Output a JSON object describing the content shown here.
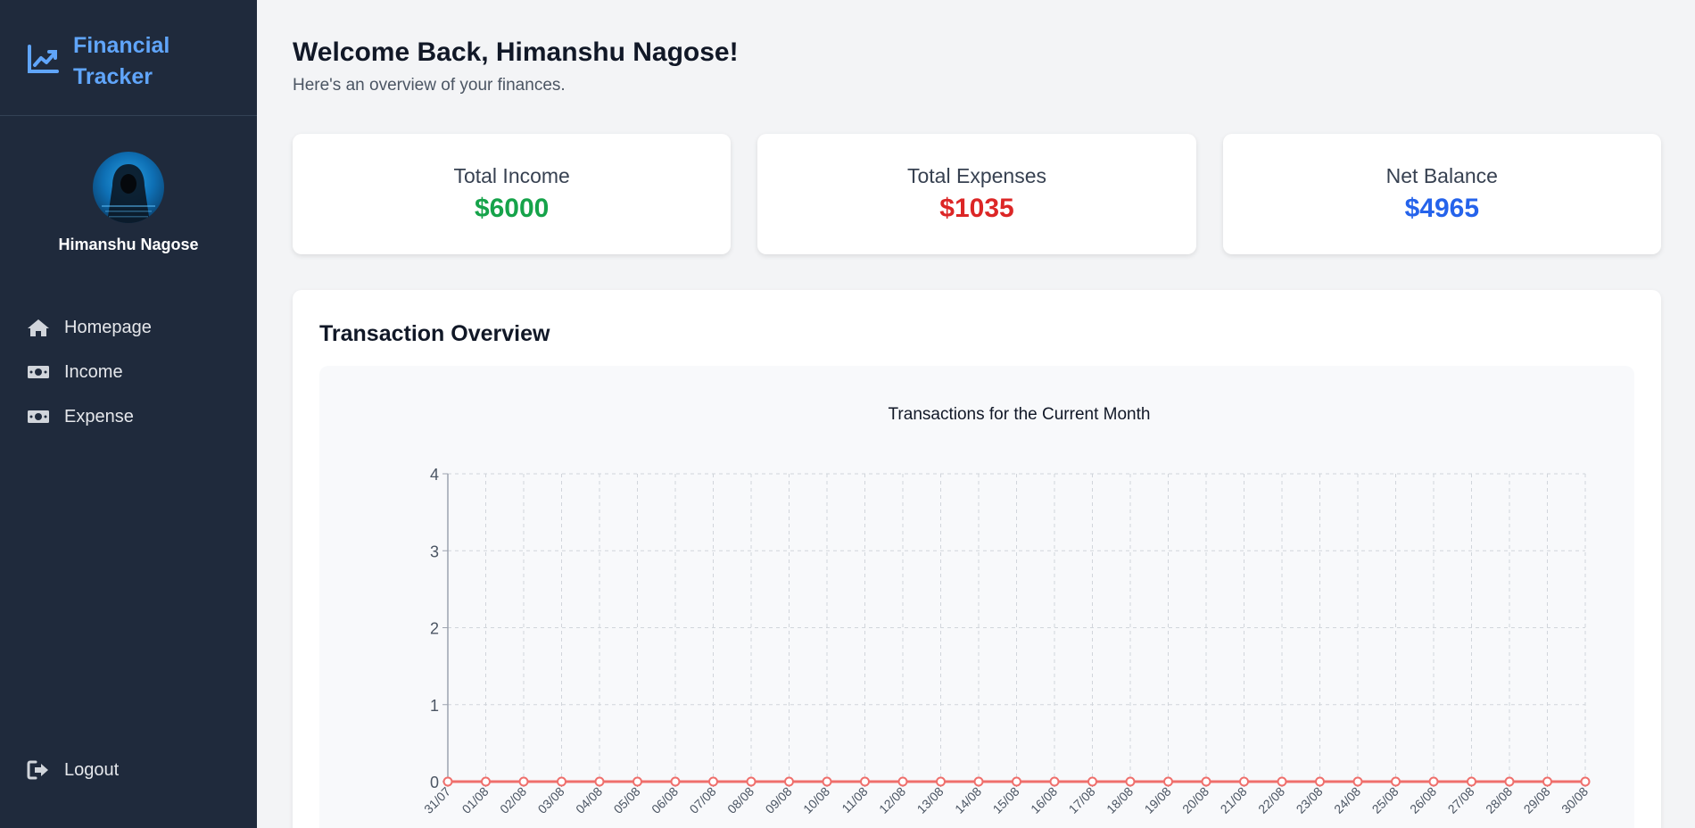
{
  "brand": {
    "title": "Financial Tracker"
  },
  "profile": {
    "name": "Himanshu Nagose"
  },
  "nav": {
    "items": [
      {
        "label": "Homepage",
        "icon": "home-icon"
      },
      {
        "label": "Income",
        "icon": "money-bill-icon"
      },
      {
        "label": "Expense",
        "icon": "money-bill-icon"
      }
    ],
    "logout": {
      "label": "Logout",
      "icon": "sign-out-icon"
    }
  },
  "header": {
    "welcome": "Welcome Back, Himanshu Nagose!",
    "subtitle": "Here's an overview of your finances."
  },
  "summary": {
    "income": {
      "label": "Total Income",
      "value": "$6000",
      "color": "#16a34a"
    },
    "expenses": {
      "label": "Total Expenses",
      "value": "$1035",
      "color": "#dc2626"
    },
    "balance": {
      "label": "Net Balance",
      "value": "$4965",
      "color": "#2563eb"
    }
  },
  "overview": {
    "title": "Transaction Overview"
  },
  "colors": {
    "sidebar": "#1f2a3c",
    "brand": "#60a5fa",
    "line": "#ef6f6c"
  },
  "chart_data": {
    "type": "line",
    "title": "Transactions for the Current Month",
    "xlabel": "",
    "ylabel": "",
    "ylim": [
      0,
      4
    ],
    "yticks": [
      0,
      1,
      2,
      3,
      4
    ],
    "grid": true,
    "categories": [
      "31/07",
      "01/08",
      "02/08",
      "03/08",
      "04/08",
      "05/08",
      "06/08",
      "07/08",
      "08/08",
      "09/08",
      "10/08",
      "11/08",
      "12/08",
      "13/08",
      "14/08",
      "15/08",
      "16/08",
      "17/08",
      "18/08",
      "19/08",
      "20/08",
      "21/08",
      "22/08",
      "23/08",
      "24/08",
      "25/08",
      "26/08",
      "27/08",
      "28/08",
      "29/08",
      "30/08"
    ],
    "series": [
      {
        "values": [
          0,
          0,
          0,
          0,
          0,
          0,
          0,
          0,
          0,
          0,
          0,
          0,
          0,
          0,
          0,
          0,
          0,
          0,
          0,
          0,
          0,
          0,
          0,
          0,
          0,
          0,
          0,
          0,
          0,
          0,
          0
        ],
        "color": "#ef6f6c"
      }
    ]
  }
}
